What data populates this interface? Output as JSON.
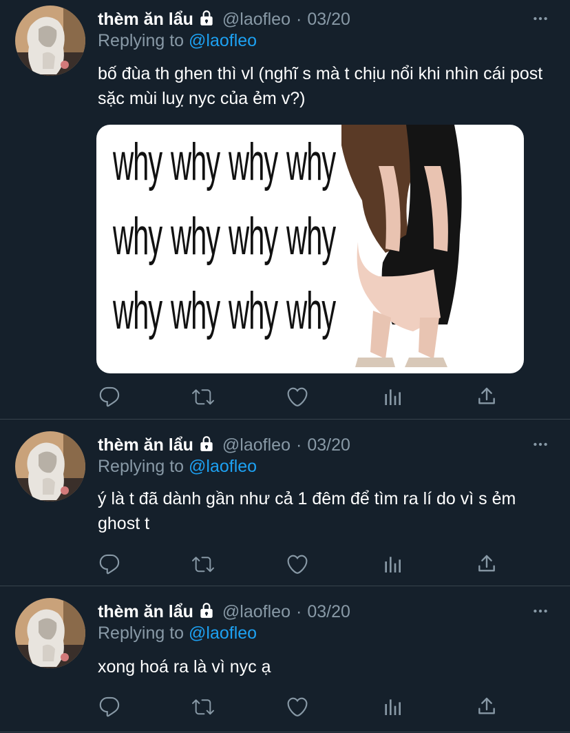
{
  "tweets": [
    {
      "author": {
        "name": "thèm ăn lẩu",
        "handle": "@laofleo",
        "date": "03/20"
      },
      "reply_prefix": "Replying to",
      "reply_to": "@laofleo",
      "text": "bố đùa th ghen thì vl (nghĩ s mà t chịu nổi khi nhìn cái post sặc mùi luỵ nyc của ẻm v?)",
      "media": {
        "caption_words": [
          "why",
          "why",
          "why",
          "why",
          "why",
          "why",
          "why",
          "why",
          "why",
          "why",
          "why",
          "why"
        ]
      }
    },
    {
      "author": {
        "name": "thèm ăn lẩu",
        "handle": "@laofleo",
        "date": "03/20"
      },
      "reply_prefix": "Replying to",
      "reply_to": "@laofleo",
      "text": "ý là t đã dành gần như cả 1 đêm để tìm ra lí do vì s ẻm ghost t"
    },
    {
      "author": {
        "name": "thèm ăn lẩu",
        "handle": "@laofleo",
        "date": "03/20"
      },
      "reply_prefix": "Replying to",
      "reply_to": "@laofleo",
      "text": "xong hoá ra là vì nyc ạ"
    }
  ],
  "icons": {
    "lock": "lock-icon",
    "more": "more-icon",
    "reply": "reply-icon",
    "retweet": "retweet-icon",
    "like": "heart-icon",
    "analytics": "analytics-icon",
    "share": "share-icon"
  },
  "colors": {
    "background": "#15202b",
    "secondary_text": "#8899a6",
    "accent": "#1da1f2",
    "divider": "#38444d"
  }
}
